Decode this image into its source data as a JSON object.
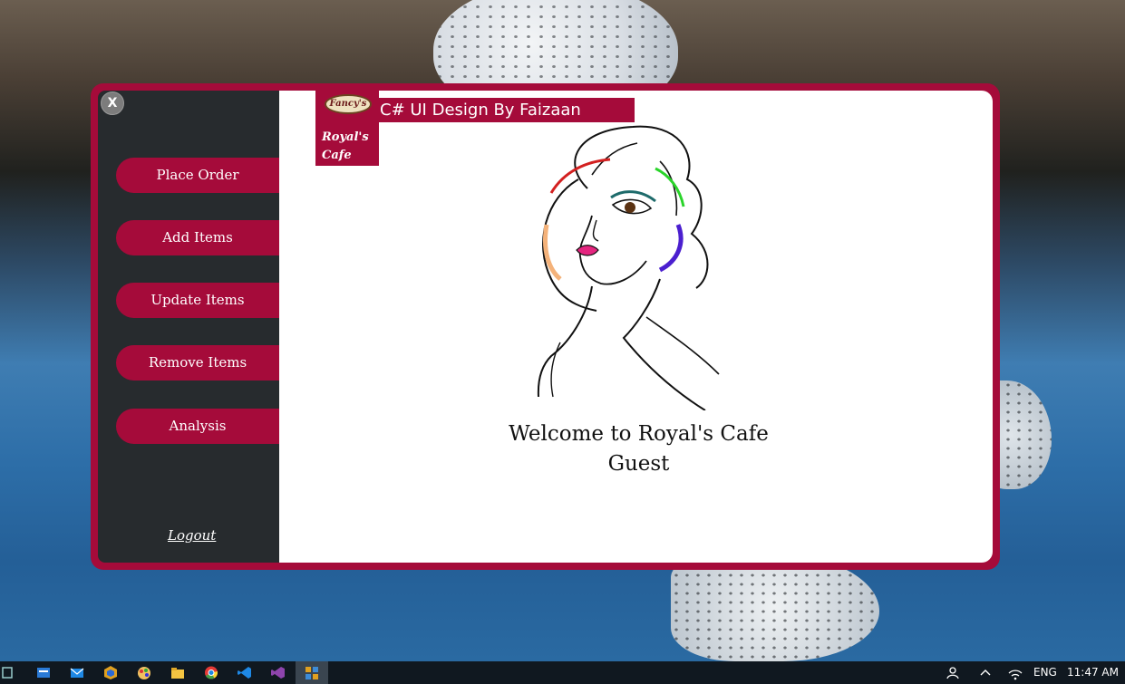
{
  "window": {
    "close_label": "X",
    "logo_badge": "Fancy's",
    "logo_text": "Royal's Cafe",
    "title": "C# UI Design By Faizaan",
    "welcome_line": "Welcome to Royal's Cafe",
    "user_name": "Guest"
  },
  "sidebar": {
    "items": [
      {
        "label": "Place Order"
      },
      {
        "label": "Add Items"
      },
      {
        "label": "Update Items"
      },
      {
        "label": "Remove Items"
      },
      {
        "label": "Analysis"
      }
    ],
    "logout_label": "Logout"
  },
  "colors": {
    "accent": "#a50b3a",
    "sidebar_bg": "#272b2e",
    "panel_bg": "#ffffff"
  },
  "taskbar": {
    "icons": [
      "task-view-icon",
      "news-icon",
      "mail-icon",
      "store-icon",
      "paint-icon",
      "file-explorer-icon",
      "chrome-icon",
      "vscode-icon",
      "visual-studio-icon",
      "app-icon"
    ],
    "language": "ENG",
    "time": "11:47 AM"
  }
}
